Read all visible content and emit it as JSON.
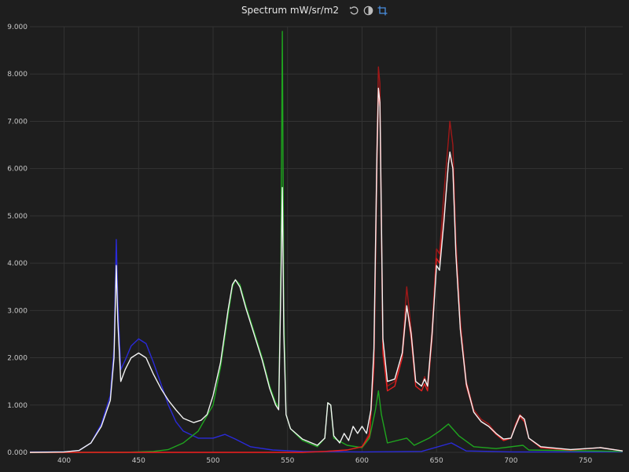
{
  "header": {
    "title": "Spectrum mW/sr/m2",
    "icons": [
      "reset-icon",
      "contrast-icon",
      "crop-icon"
    ]
  },
  "colors": {
    "background": "#1e1e1e",
    "grid": "#333333",
    "white": "#f2f2f2",
    "red": "#e02020",
    "dark_red": "#a01818",
    "green": "#1fa51f",
    "blue": "#2a2ad8"
  },
  "chart_data": {
    "type": "line",
    "title": "Spectrum mW/sr/m2",
    "xlabel": "",
    "ylabel": "",
    "xlim": [
      377,
      775
    ],
    "ylim": [
      0,
      9
    ],
    "grid": true,
    "x_ticks": [
      400,
      450,
      500,
      550,
      600,
      650,
      700,
      750
    ],
    "x_tick_labels": [
      "400",
      "450",
      "500",
      "550",
      "600",
      "650",
      "700",
      "750"
    ],
    "y_ticks": [
      0,
      1,
      2,
      3,
      4,
      5,
      6,
      7,
      8,
      9
    ],
    "y_tick_labels": [
      "0.000",
      "1.000",
      "2.000",
      "3.000",
      "4.000",
      "5.000",
      "6.000",
      "7.000",
      "8.000",
      "9.000"
    ],
    "series": [
      {
        "color_key": "blue",
        "points": [
          [
            377,
            0.01
          ],
          [
            400,
            0.01
          ],
          [
            410,
            0.04
          ],
          [
            418,
            0.2
          ],
          [
            425,
            0.6
          ],
          [
            431,
            1.2
          ],
          [
            433.5,
            2.2
          ],
          [
            435,
            4.5
          ],
          [
            436,
            3.2
          ],
          [
            438,
            1.75
          ],
          [
            441,
            1.95
          ],
          [
            445,
            2.25
          ],
          [
            450,
            2.4
          ],
          [
            455,
            2.3
          ],
          [
            460,
            1.9
          ],
          [
            465,
            1.45
          ],
          [
            470,
            1.0
          ],
          [
            475,
            0.65
          ],
          [
            480,
            0.45
          ],
          [
            490,
            0.3
          ],
          [
            500,
            0.3
          ],
          [
            508,
            0.38
          ],
          [
            515,
            0.28
          ],
          [
            525,
            0.12
          ],
          [
            540,
            0.05
          ],
          [
            560,
            0.02
          ],
          [
            600,
            0.01
          ],
          [
            640,
            0.02
          ],
          [
            660,
            0.2
          ],
          [
            670,
            0.03
          ],
          [
            700,
            0.01
          ],
          [
            775,
            0.01
          ]
        ]
      },
      {
        "color_key": "green",
        "points": [
          [
            377,
            0
          ],
          [
            440,
            0
          ],
          [
            460,
            0.02
          ],
          [
            470,
            0.06
          ],
          [
            480,
            0.2
          ],
          [
            490,
            0.45
          ],
          [
            500,
            1.0
          ],
          [
            505,
            1.8
          ],
          [
            510,
            2.9
          ],
          [
            513,
            3.5
          ],
          [
            515,
            3.65
          ],
          [
            518,
            3.55
          ],
          [
            522,
            3.1
          ],
          [
            527,
            2.6
          ],
          [
            533,
            2.0
          ],
          [
            538,
            1.4
          ],
          [
            542,
            1.05
          ],
          [
            544,
            0.95
          ],
          [
            545.5,
            4.0
          ],
          [
            546.5,
            8.9
          ],
          [
            547.5,
            3.0
          ],
          [
            549,
            0.8
          ],
          [
            552,
            0.5
          ],
          [
            560,
            0.25
          ],
          [
            570,
            0.12
          ],
          [
            575,
            0.3
          ],
          [
            577,
            1.05
          ],
          [
            579,
            1.0
          ],
          [
            581,
            0.3
          ],
          [
            590,
            0.15
          ],
          [
            600,
            0.1
          ],
          [
            605,
            0.3
          ],
          [
            609,
            0.9
          ],
          [
            611,
            1.3
          ],
          [
            613,
            0.8
          ],
          [
            617,
            0.2
          ],
          [
            630,
            0.3
          ],
          [
            635,
            0.15
          ],
          [
            645,
            0.3
          ],
          [
            652,
            0.45
          ],
          [
            658,
            0.6
          ],
          [
            665,
            0.35
          ],
          [
            675,
            0.12
          ],
          [
            690,
            0.08
          ],
          [
            708,
            0.15
          ],
          [
            712,
            0.05
          ],
          [
            775,
            0.02
          ]
        ]
      },
      {
        "color_key": "dark_red",
        "points": [
          [
            377,
            0
          ],
          [
            560,
            0
          ],
          [
            575,
            0.02
          ],
          [
            590,
            0.05
          ],
          [
            600,
            0.12
          ],
          [
            605,
            0.4
          ],
          [
            608,
            2.0
          ],
          [
            610,
            6.5
          ],
          [
            611,
            8.15
          ],
          [
            612,
            7.8
          ],
          [
            614,
            2.2
          ],
          [
            617,
            1.4
          ],
          [
            622,
            1.5
          ],
          [
            627,
            2.1
          ],
          [
            630,
            3.5
          ],
          [
            633,
            2.6
          ],
          [
            636,
            1.5
          ],
          [
            640,
            1.4
          ],
          [
            642,
            1.6
          ],
          [
            644,
            1.4
          ],
          [
            647,
            2.6
          ],
          [
            650,
            4.3
          ],
          [
            652,
            4.2
          ],
          [
            655,
            5.5
          ],
          [
            658,
            6.6
          ],
          [
            659,
            7.0
          ],
          [
            661,
            6.5
          ],
          [
            663,
            4.5
          ],
          [
            666,
            2.8
          ],
          [
            670,
            1.5
          ],
          [
            675,
            0.9
          ],
          [
            680,
            0.7
          ],
          [
            685,
            0.6
          ],
          [
            690,
            0.4
          ],
          [
            695,
            0.25
          ],
          [
            700,
            0.3
          ],
          [
            703,
            0.6
          ],
          [
            706,
            0.8
          ],
          [
            709,
            0.7
          ],
          [
            712,
            0.3
          ],
          [
            720,
            0.1
          ],
          [
            740,
            0.05
          ],
          [
            760,
            0.1
          ],
          [
            775,
            0.03
          ]
        ]
      },
      {
        "color_key": "red",
        "points": [
          [
            377,
            0
          ],
          [
            560,
            0
          ],
          [
            575,
            0.02
          ],
          [
            590,
            0.05
          ],
          [
            600,
            0.12
          ],
          [
            605,
            0.35
          ],
          [
            608,
            1.8
          ],
          [
            610,
            6.0
          ],
          [
            611,
            7.65
          ],
          [
            612,
            7.3
          ],
          [
            614,
            2.1
          ],
          [
            617,
            1.3
          ],
          [
            622,
            1.4
          ],
          [
            627,
            2.0
          ],
          [
            630,
            3.1
          ],
          [
            633,
            2.4
          ],
          [
            636,
            1.4
          ],
          [
            640,
            1.3
          ],
          [
            642,
            1.45
          ],
          [
            644,
            1.3
          ],
          [
            647,
            2.4
          ],
          [
            650,
            4.1
          ],
          [
            652,
            4.0
          ],
          [
            655,
            5.0
          ],
          [
            658,
            6.1
          ],
          [
            659,
            6.3
          ],
          [
            661,
            6.0
          ],
          [
            663,
            4.2
          ],
          [
            666,
            2.6
          ],
          [
            670,
            1.4
          ],
          [
            675,
            0.85
          ],
          [
            680,
            0.65
          ],
          [
            685,
            0.55
          ],
          [
            690,
            0.38
          ],
          [
            695,
            0.25
          ],
          [
            700,
            0.3
          ],
          [
            703,
            0.55
          ],
          [
            706,
            0.75
          ],
          [
            709,
            0.65
          ],
          [
            712,
            0.3
          ],
          [
            720,
            0.1
          ],
          [
            740,
            0.05
          ],
          [
            760,
            0.1
          ],
          [
            775,
            0.03
          ]
        ]
      },
      {
        "color_key": "white",
        "points": [
          [
            377,
            0
          ],
          [
            400,
            0.01
          ],
          [
            410,
            0.04
          ],
          [
            418,
            0.2
          ],
          [
            425,
            0.55
          ],
          [
            431,
            1.1
          ],
          [
            433.5,
            2.0
          ],
          [
            435,
            3.95
          ],
          [
            436,
            2.8
          ],
          [
            438,
            1.5
          ],
          [
            441,
            1.75
          ],
          [
            445,
            2.0
          ],
          [
            450,
            2.1
          ],
          [
            455,
            2.0
          ],
          [
            460,
            1.65
          ],
          [
            465,
            1.35
          ],
          [
            470,
            1.1
          ],
          [
            475,
            0.9
          ],
          [
            480,
            0.72
          ],
          [
            487,
            0.63
          ],
          [
            492,
            0.68
          ],
          [
            496,
            0.8
          ],
          [
            500,
            1.2
          ],
          [
            505,
            1.9
          ],
          [
            510,
            3.0
          ],
          [
            513,
            3.55
          ],
          [
            515,
            3.65
          ],
          [
            518,
            3.5
          ],
          [
            522,
            3.05
          ],
          [
            527,
            2.55
          ],
          [
            533,
            1.95
          ],
          [
            538,
            1.35
          ],
          [
            542,
            1.0
          ],
          [
            544,
            0.9
          ],
          [
            545.5,
            3.5
          ],
          [
            546.5,
            5.6
          ],
          [
            547.5,
            2.5
          ],
          [
            549,
            0.8
          ],
          [
            552,
            0.5
          ],
          [
            560,
            0.28
          ],
          [
            570,
            0.15
          ],
          [
            575,
            0.3
          ],
          [
            577,
            1.05
          ],
          [
            579,
            1.0
          ],
          [
            581,
            0.35
          ],
          [
            585,
            0.2
          ],
          [
            588,
            0.4
          ],
          [
            591,
            0.25
          ],
          [
            594,
            0.55
          ],
          [
            597,
            0.4
          ],
          [
            600,
            0.55
          ],
          [
            603,
            0.4
          ],
          [
            606,
            0.9
          ],
          [
            608,
            2.2
          ],
          [
            610,
            6.3
          ],
          [
            611,
            7.7
          ],
          [
            612,
            7.4
          ],
          [
            614,
            2.4
          ],
          [
            617,
            1.5
          ],
          [
            622,
            1.55
          ],
          [
            627,
            2.1
          ],
          [
            630,
            3.1
          ],
          [
            633,
            2.5
          ],
          [
            636,
            1.5
          ],
          [
            640,
            1.4
          ],
          [
            642,
            1.55
          ],
          [
            644,
            1.4
          ],
          [
            647,
            2.5
          ],
          [
            650,
            3.95
          ],
          [
            652,
            3.85
          ],
          [
            655,
            4.9
          ],
          [
            658,
            6.1
          ],
          [
            659,
            6.35
          ],
          [
            661,
            6.0
          ],
          [
            663,
            4.2
          ],
          [
            666,
            2.6
          ],
          [
            670,
            1.45
          ],
          [
            675,
            0.85
          ],
          [
            680,
            0.65
          ],
          [
            685,
            0.55
          ],
          [
            690,
            0.4
          ],
          [
            695,
            0.28
          ],
          [
            700,
            0.3
          ],
          [
            703,
            0.55
          ],
          [
            706,
            0.78
          ],
          [
            709,
            0.7
          ],
          [
            712,
            0.3
          ],
          [
            720,
            0.12
          ],
          [
            740,
            0.06
          ],
          [
            760,
            0.1
          ],
          [
            775,
            0.03
          ]
        ]
      }
    ]
  }
}
